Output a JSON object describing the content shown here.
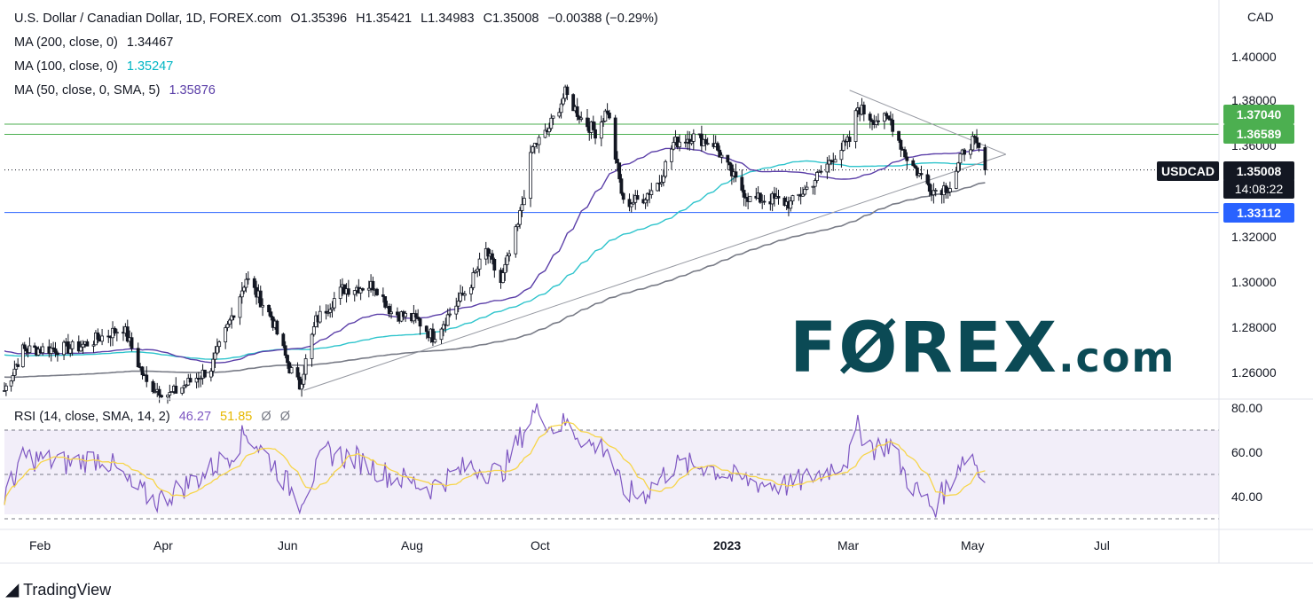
{
  "header": {
    "symbol": "U.S. Dollar / Canadian Dollar, 1D, FOREX.com",
    "open": "O1.35396",
    "high": "H1.35421",
    "low": "L1.34983",
    "close": "C1.35008",
    "change": "−0.00388 (−0.29%)"
  },
  "legend": {
    "ma200_label": "MA (200, close, 0)",
    "ma200_value": "1.34467",
    "ma100_label": "MA (100, close, 0)",
    "ma100_value": "1.35247",
    "ma50_label": "MA (50, close, 0, SMA, 5)",
    "ma50_value": "1.35876",
    "rsi_label": "RSI (14, close, SMA, 14, 2)",
    "rsi_value": "46.27",
    "rsi_sma_value": "51.85",
    "rsi_extra1": "Ø",
    "rsi_extra2": "Ø"
  },
  "axis": {
    "currency": "CAD",
    "price_ticks": [
      "1.40000",
      "1.38000",
      "1.36000",
      "1.32000",
      "1.30000",
      "1.28000",
      "1.26000"
    ],
    "rsi_ticks": [
      "80.00",
      "60.00",
      "40.00"
    ],
    "time_ticks": [
      "Feb",
      "Apr",
      "Jun",
      "Aug",
      "Oct",
      "2023",
      "Mar",
      "May",
      "Jul"
    ]
  },
  "price_tags": {
    "level1": "1.37040",
    "level2": "1.36589",
    "symbol": "USDCAD",
    "last": "1.35008",
    "countdown": "14:08:22",
    "level3": "1.33112"
  },
  "watermark": {
    "brand": "FØREX",
    "suffix": ".com"
  },
  "footer": {
    "logo": "TradingView"
  },
  "colors": {
    "candle": "#131722",
    "ma200": "#787b86",
    "ma100": "#2ec4cc",
    "ma50": "#5b3fa8",
    "rsi": "#7e57c2",
    "rsi_sma": "#f7d54a",
    "level_green": "#4caf50",
    "level_blue": "#2962ff",
    "brand_dark": "#0b4a55",
    "brand_green": "#1db954"
  },
  "chart_data": {
    "type": "candlestick",
    "title": "U.S. Dollar / Canadian Dollar, 1D, FOREX.com",
    "ylim": [
      1.245,
      1.41
    ],
    "rsi_ylim": [
      25,
      85
    ],
    "horizontal_levels": [
      1.3704,
      1.36589,
      1.33112
    ],
    "last_price": 1.35008,
    "anchors": {
      "x_dates": [
        "2022-01-13",
        "2022-02-01",
        "2022-04-01",
        "2022-06-01",
        "2022-08-01",
        "2022-10-01",
        "2023-01-01",
        "2023-03-01",
        "2023-05-01",
        "2023-07-01",
        "2023-07-28"
      ],
      "price_keypoints": [
        [
          "2022-01-13",
          1.252
        ],
        [
          "2022-01-24",
          1.27
        ],
        [
          "2022-02-20",
          1.271
        ],
        [
          "2022-03-14",
          1.28
        ],
        [
          "2022-03-25",
          1.255
        ],
        [
          "2022-04-05",
          1.25
        ],
        [
          "2022-04-25",
          1.262
        ],
        [
          "2022-05-03",
          1.28
        ],
        [
          "2022-05-12",
          1.302
        ],
        [
          "2022-05-24",
          1.285
        ],
        [
          "2022-06-02",
          1.262
        ],
        [
          "2022-06-07",
          1.254
        ],
        [
          "2022-06-15",
          1.283
        ],
        [
          "2022-06-28",
          1.297
        ],
        [
          "2022-07-14",
          1.299
        ],
        [
          "2022-07-22",
          1.287
        ],
        [
          "2022-08-04",
          1.283
        ],
        [
          "2022-08-11",
          1.276
        ],
        [
          "2022-08-28",
          1.298
        ],
        [
          "2022-09-05",
          1.314
        ],
        [
          "2022-09-12",
          1.3
        ],
        [
          "2022-09-20",
          1.325
        ],
        [
          "2022-09-27",
          1.36
        ],
        [
          "2022-10-04",
          1.367
        ],
        [
          "2022-10-13",
          1.384
        ],
        [
          "2022-10-21",
          1.373
        ],
        [
          "2022-10-28",
          1.367
        ],
        [
          "2022-11-03",
          1.377
        ],
        [
          "2022-11-11",
          1.335
        ],
        [
          "2022-11-20",
          1.337
        ],
        [
          "2022-11-29",
          1.345
        ],
        [
          "2022-12-06",
          1.362
        ],
        [
          "2022-12-15",
          1.365
        ],
        [
          "2022-12-26",
          1.362
        ],
        [
          "2023-01-06",
          1.345
        ],
        [
          "2023-01-13",
          1.337
        ],
        [
          "2023-01-24",
          1.337
        ],
        [
          "2023-02-02",
          1.335
        ],
        [
          "2023-02-10",
          1.342
        ],
        [
          "2023-02-17",
          1.349
        ],
        [
          "2023-02-23",
          1.356
        ],
        [
          "2023-03-03",
          1.363
        ],
        [
          "2023-03-07",
          1.378
        ],
        [
          "2023-03-14",
          1.373
        ],
        [
          "2023-03-23",
          1.372
        ],
        [
          "2023-03-30",
          1.357
        ],
        [
          "2023-04-06",
          1.348
        ],
        [
          "2023-04-13",
          1.341
        ],
        [
          "2023-04-21",
          1.343
        ],
        [
          "2023-04-28",
          1.359
        ],
        [
          "2023-05-02",
          1.363
        ],
        [
          "2023-05-05",
          1.3585
        ],
        [
          "2023-05-08",
          1.35008
        ]
      ],
      "rsi_keypoints": [
        [
          "2022-01-13",
          40
        ],
        [
          "2022-01-25",
          58
        ],
        [
          "2022-02-15",
          55
        ],
        [
          "2022-03-05",
          58
        ],
        [
          "2022-03-18",
          44
        ],
        [
          "2022-03-30",
          38
        ],
        [
          "2022-04-20",
          49
        ],
        [
          "2022-05-05",
          60
        ],
        [
          "2022-05-12",
          69
        ],
        [
          "2022-05-25",
          55
        ],
        [
          "2022-06-07",
          38
        ],
        [
          "2022-06-20",
          60
        ],
        [
          "2022-07-05",
          57
        ],
        [
          "2022-07-20",
          50
        ],
        [
          "2022-08-10",
          44
        ],
        [
          "2022-08-28",
          54
        ],
        [
          "2022-09-12",
          50
        ],
        [
          "2022-09-27",
          77
        ],
        [
          "2022-10-01",
          80
        ],
        [
          "2022-10-06",
          71
        ],
        [
          "2022-10-13",
          73
        ],
        [
          "2022-10-26",
          63
        ],
        [
          "2022-11-03",
          62
        ],
        [
          "2022-11-10",
          43
        ],
        [
          "2022-11-20",
          40
        ],
        [
          "2022-12-06",
          54
        ],
        [
          "2022-12-22",
          54
        ],
        [
          "2023-01-06",
          48
        ],
        [
          "2023-01-20",
          46
        ],
        [
          "2023-02-02",
          45
        ],
        [
          "2023-02-20",
          52
        ],
        [
          "2023-03-03",
          58
        ],
        [
          "2023-03-07",
          71
        ],
        [
          "2023-03-15",
          62
        ],
        [
          "2023-03-23",
          64
        ],
        [
          "2023-03-30",
          50
        ],
        [
          "2023-04-06",
          41
        ],
        [
          "2023-04-13",
          35
        ],
        [
          "2023-04-20",
          45
        ],
        [
          "2023-04-26",
          56
        ],
        [
          "2023-05-02",
          59
        ],
        [
          "2023-05-05",
          52
        ],
        [
          "2023-05-08",
          46.27
        ]
      ],
      "trendlines": [
        [
          [
            "2022-06-09",
            1.252
          ],
          [
            "2023-05-18",
            1.357
          ]
        ],
        [
          [
            "2023-03-03",
            1.3855
          ],
          [
            "2023-05-18",
            1.357
          ]
        ]
      ]
    }
  }
}
